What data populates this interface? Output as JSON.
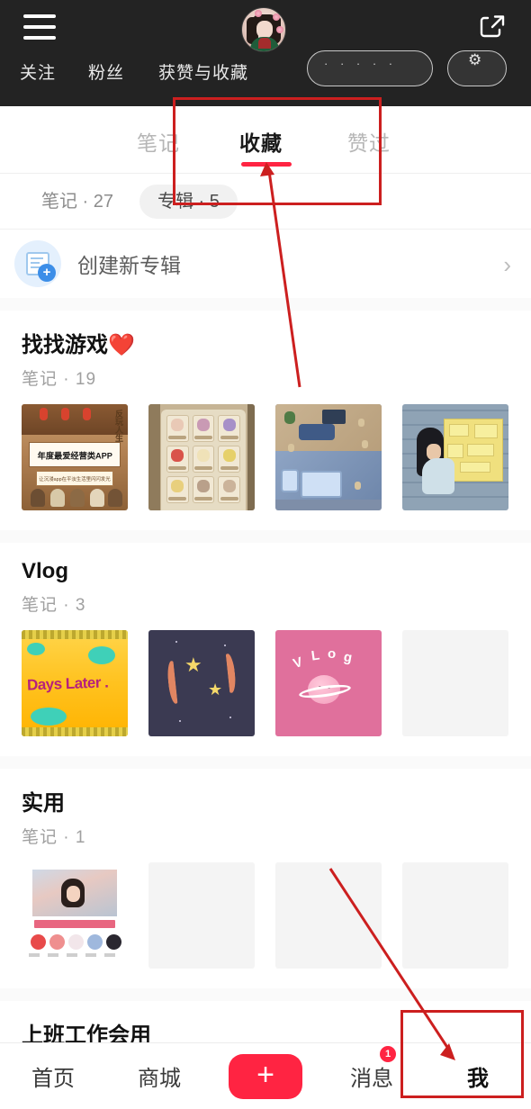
{
  "header": {
    "menu_icon": "hamburger-menu-icon",
    "avatar_alt": "user-avatar",
    "share_icon": "share-external-icon",
    "stats": [
      {
        "label": "关注"
      },
      {
        "label": "粉丝"
      },
      {
        "label": "获赞与收藏"
      }
    ],
    "edit_profile_label": "",
    "settings_icon": "gear-icon"
  },
  "tabs": [
    {
      "label": "笔记",
      "active": false
    },
    {
      "label": "收藏",
      "active": true
    },
    {
      "label": "赞过",
      "active": false
    }
  ],
  "chips": [
    {
      "label": "笔记 · 27",
      "active": false
    },
    {
      "label": "专辑 · 5",
      "active": true
    }
  ],
  "create_album": {
    "label": "创建新专辑",
    "icon": "create-album-icon",
    "chevron": "›"
  },
  "albums": [
    {
      "title": "找找游戏❤️",
      "subtitle": "笔记 · 19",
      "thumbs": [
        "game-poster",
        "item-grid",
        "isometric-room",
        "stone-notes"
      ],
      "thumb_texts": {
        "poster_main": "年度最爱经营类APP",
        "poster_sub": "让沉浸app在平淡生活里闪闪发光",
        "poster_vertical": "反玩人生"
      }
    },
    {
      "title": "Vlog",
      "subtitle": "笔记 · 3",
      "thumbs": [
        "days-later",
        "navy-stars",
        "pink-vlog",
        "empty"
      ],
      "thumb_texts": {
        "days_text": "Days Later .",
        "vlog_text": "V L O g"
      }
    },
    {
      "title": "实用",
      "subtitle": "笔记 · 1",
      "thumbs": [
        "photo-swatches",
        "empty",
        "empty",
        "empty"
      ]
    }
  ],
  "cut_off_album_title": "上班工作会用",
  "bottom_nav": {
    "items": [
      {
        "label": "首页",
        "active": false
      },
      {
        "label": "商城",
        "active": false
      },
      {
        "label": "消息",
        "active": false,
        "badge": "1"
      },
      {
        "label": "我",
        "active": true
      }
    ],
    "plus_label": "+"
  },
  "colors": {
    "brand_red": "#ff2442",
    "annotation_red": "#cc1f1f",
    "header_dark": "#232323",
    "chip_active_bg": "#f1f1f1"
  }
}
